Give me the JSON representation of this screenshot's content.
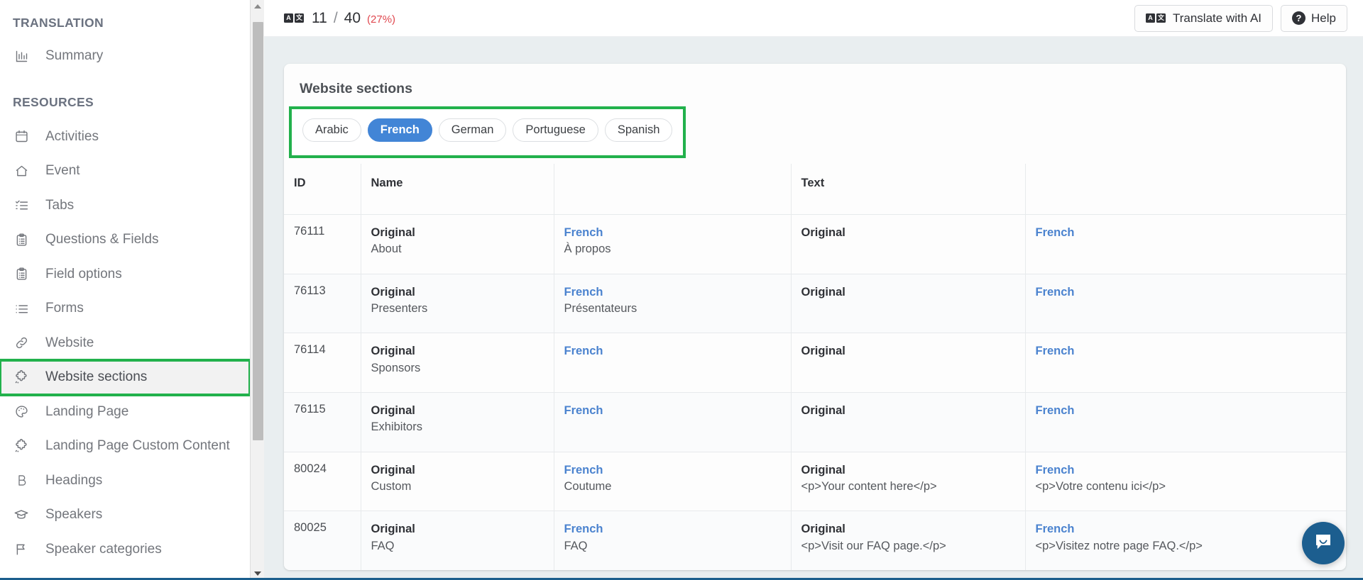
{
  "sidebar": {
    "groups": [
      {
        "title": "TRANSLATION",
        "items": [
          {
            "label": "Summary",
            "icon": "bar-chart-icon"
          }
        ]
      },
      {
        "title": "RESOURCES",
        "items": [
          {
            "label": "Activities",
            "icon": "calendar-icon"
          },
          {
            "label": "Event",
            "icon": "home-icon"
          },
          {
            "label": "Tabs",
            "icon": "checklist-icon"
          },
          {
            "label": "Questions & Fields",
            "icon": "clipboard-list-icon"
          },
          {
            "label": "Field options",
            "icon": "clipboard-list-icon"
          },
          {
            "label": "Forms",
            "icon": "list-icon"
          },
          {
            "label": "Website",
            "icon": "link-icon"
          },
          {
            "label": "Website sections",
            "icon": "puzzle-icon"
          },
          {
            "label": "Landing Page",
            "icon": "palette-icon"
          },
          {
            "label": "Landing Page Custom Content",
            "icon": "puzzle-icon"
          },
          {
            "label": "Headings",
            "icon": "bold-b-icon"
          },
          {
            "label": "Speakers",
            "icon": "graduation-cap-icon"
          },
          {
            "label": "Speaker categories",
            "icon": "flag-icon"
          }
        ]
      }
    ],
    "active_item": "Website sections"
  },
  "topbar": {
    "translate_badge_left": "A",
    "translate_badge_right": "文",
    "current": "11",
    "separator": "/",
    "total": "40",
    "percent": "(27%)",
    "translate_ai_label": "Translate with AI",
    "help_label": "Help",
    "help_glyph": "?"
  },
  "card": {
    "title": "Website sections",
    "languages": [
      {
        "label": "Arabic",
        "selected": false
      },
      {
        "label": "French",
        "selected": true
      },
      {
        "label": "German",
        "selected": false
      },
      {
        "label": "Portuguese",
        "selected": false
      },
      {
        "label": "Spanish",
        "selected": false
      }
    ],
    "table": {
      "headers": [
        "ID",
        "Name",
        "",
        "Text",
        ""
      ],
      "rows": [
        {
          "id": "76111",
          "name_original_label": "Original",
          "name_original_value": "About",
          "name_translated_label": "French",
          "name_translated_value": "À propos",
          "text_original_label": "Original",
          "text_original_value": "",
          "text_translated_label": "French",
          "text_translated_value": ""
        },
        {
          "id": "76113",
          "name_original_label": "Original",
          "name_original_value": "Presenters",
          "name_translated_label": "French",
          "name_translated_value": "Présentateurs",
          "text_original_label": "Original",
          "text_original_value": "",
          "text_translated_label": "French",
          "text_translated_value": ""
        },
        {
          "id": "76114",
          "name_original_label": "Original",
          "name_original_value": "Sponsors",
          "name_translated_label": "French",
          "name_translated_value": "",
          "text_original_label": "Original",
          "text_original_value": "",
          "text_translated_label": "French",
          "text_translated_value": ""
        },
        {
          "id": "76115",
          "name_original_label": "Original",
          "name_original_value": "Exhibitors",
          "name_translated_label": "French",
          "name_translated_value": "",
          "text_original_label": "Original",
          "text_original_value": "",
          "text_translated_label": "French",
          "text_translated_value": ""
        },
        {
          "id": "80024",
          "name_original_label": "Original",
          "name_original_value": "Custom",
          "name_translated_label": "French",
          "name_translated_value": "Coutume",
          "text_original_label": "Original",
          "text_original_value": "<p>Your content here</p>",
          "text_translated_label": "French",
          "text_translated_value": "<p>Votre contenu ici</p>"
        },
        {
          "id": "80025",
          "name_original_label": "Original",
          "name_original_value": "FAQ",
          "name_translated_label": "French",
          "name_translated_value": "FAQ",
          "text_original_label": "Original",
          "text_original_value": "<p>Visit our FAQ page.</p>",
          "text_translated_label": "French",
          "text_translated_value": "<p>Visitez notre page FAQ.</p>"
        }
      ]
    }
  },
  "colors": {
    "accent_blue": "#4285d6",
    "highlight_green": "#22b14c",
    "link_blue": "#4b83cf",
    "percent_red": "#e0484f",
    "intercom_blue": "#1c5e8f",
    "page_bg": "#e9eef0"
  }
}
